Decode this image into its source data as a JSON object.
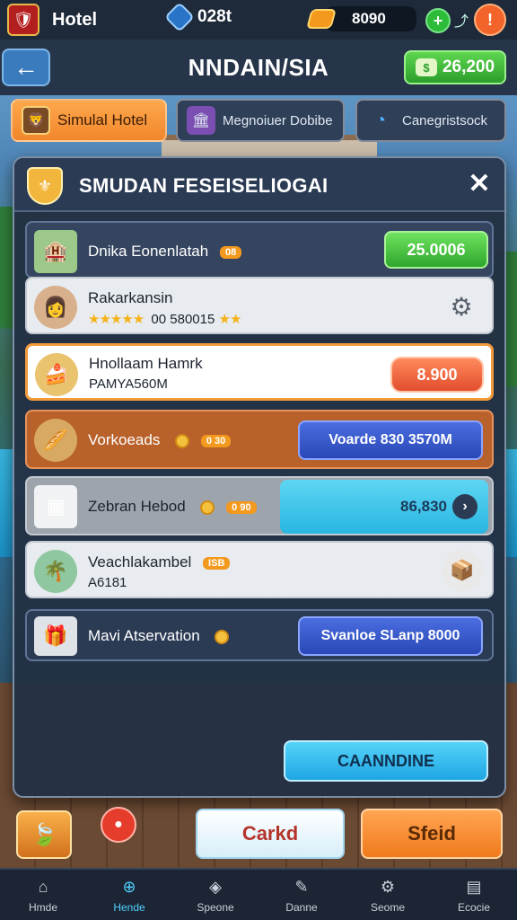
{
  "topbar": {
    "app_name": "Hotel",
    "gems": "028t",
    "gold": "8090",
    "plus_label": "+",
    "menu_label": "!"
  },
  "header": {
    "back_label": "←",
    "title": "NNDAIN/SIA",
    "cash": "26,200"
  },
  "tabs": [
    {
      "label": "Simulal Hotel",
      "active": true
    },
    {
      "label": "Megnoiuer Dobibe"
    },
    {
      "label": "Canegristsock"
    }
  ],
  "modal": {
    "title": "SMUDAN FESEISELIOGAI",
    "close_label": "✕",
    "rows": [
      {
        "title": "Dnika Eonenlatah",
        "tag": "08",
        "button": "25.0006"
      },
      {
        "title": "Rakarkansin",
        "rating_text": "00 580015"
      },
      {
        "title": "Hnollaam Hamrk",
        "subtitle": "PAMYA560M",
        "button": "8.900"
      },
      {
        "title": "Vorkoeads",
        "tag": "0 30",
        "button": "Voarde 830 3570M"
      },
      {
        "title": "Zebran Hebod",
        "tag": "0 90",
        "value": "86,830"
      },
      {
        "title": "Veachlakambel",
        "subtitle": "A6181",
        "tag": "ISB"
      },
      {
        "title": "Mavi Atservation",
        "button": "Svanloe SLanp 8000"
      }
    ],
    "continue_label": "CAANNDINE"
  },
  "actions": {
    "cancel_label": "Carkd",
    "start_label": "Sfeid"
  },
  "bottom_nav": [
    {
      "label": "Hmde",
      "icon": "home-icon"
    },
    {
      "label": "Hende",
      "icon": "globe-icon",
      "active": true
    },
    {
      "label": "Speone",
      "icon": "shield-icon"
    },
    {
      "label": "Danne",
      "icon": "pen-icon"
    },
    {
      "label": "Seome",
      "icon": "gear-icon"
    },
    {
      "label": "Ecocie",
      "icon": "chart-icon"
    }
  ]
}
